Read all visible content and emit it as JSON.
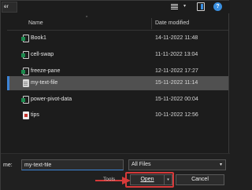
{
  "toolbar": {
    "left_label": "er",
    "icons": [
      "view-icon",
      "chevron-down-icon",
      "preview-pane-icon",
      "help-icon"
    ],
    "help_label": "?"
  },
  "list": {
    "columns": {
      "name": "Name",
      "date": "Date modified",
      "sort_indicator": "^"
    },
    "rows": [
      {
        "name": "Book1",
        "date": "14-11-2022 11:48",
        "icon": "excel-icon"
      },
      {
        "name": "cell-swap",
        "date": "11-11-2022 13:04",
        "icon": "excel-icon"
      },
      {
        "name": "freeze-pane",
        "date": "12-11-2022 17:27",
        "icon": "excel-icon"
      },
      {
        "name": "my-text-file",
        "date": "15-11-2022 11:14",
        "icon": "text-file-icon",
        "selected": true
      },
      {
        "name": "power-pivot-data",
        "date": "15-11-2022 00:04",
        "icon": "excel-icon"
      },
      {
        "name": "tips",
        "date": "10-11-2022 12:56",
        "icon": "pdf-icon"
      }
    ]
  },
  "bottom": {
    "file_name_label": "me:",
    "file_name_value": "my-text-file",
    "file_type": "All Files",
    "tools_label": "Tools",
    "open_label": "Open",
    "cancel_label": "Cancel"
  },
  "colors": {
    "accent": "#3d84d6",
    "highlight": "#d63a3a",
    "background": "#1c1c1c"
  }
}
